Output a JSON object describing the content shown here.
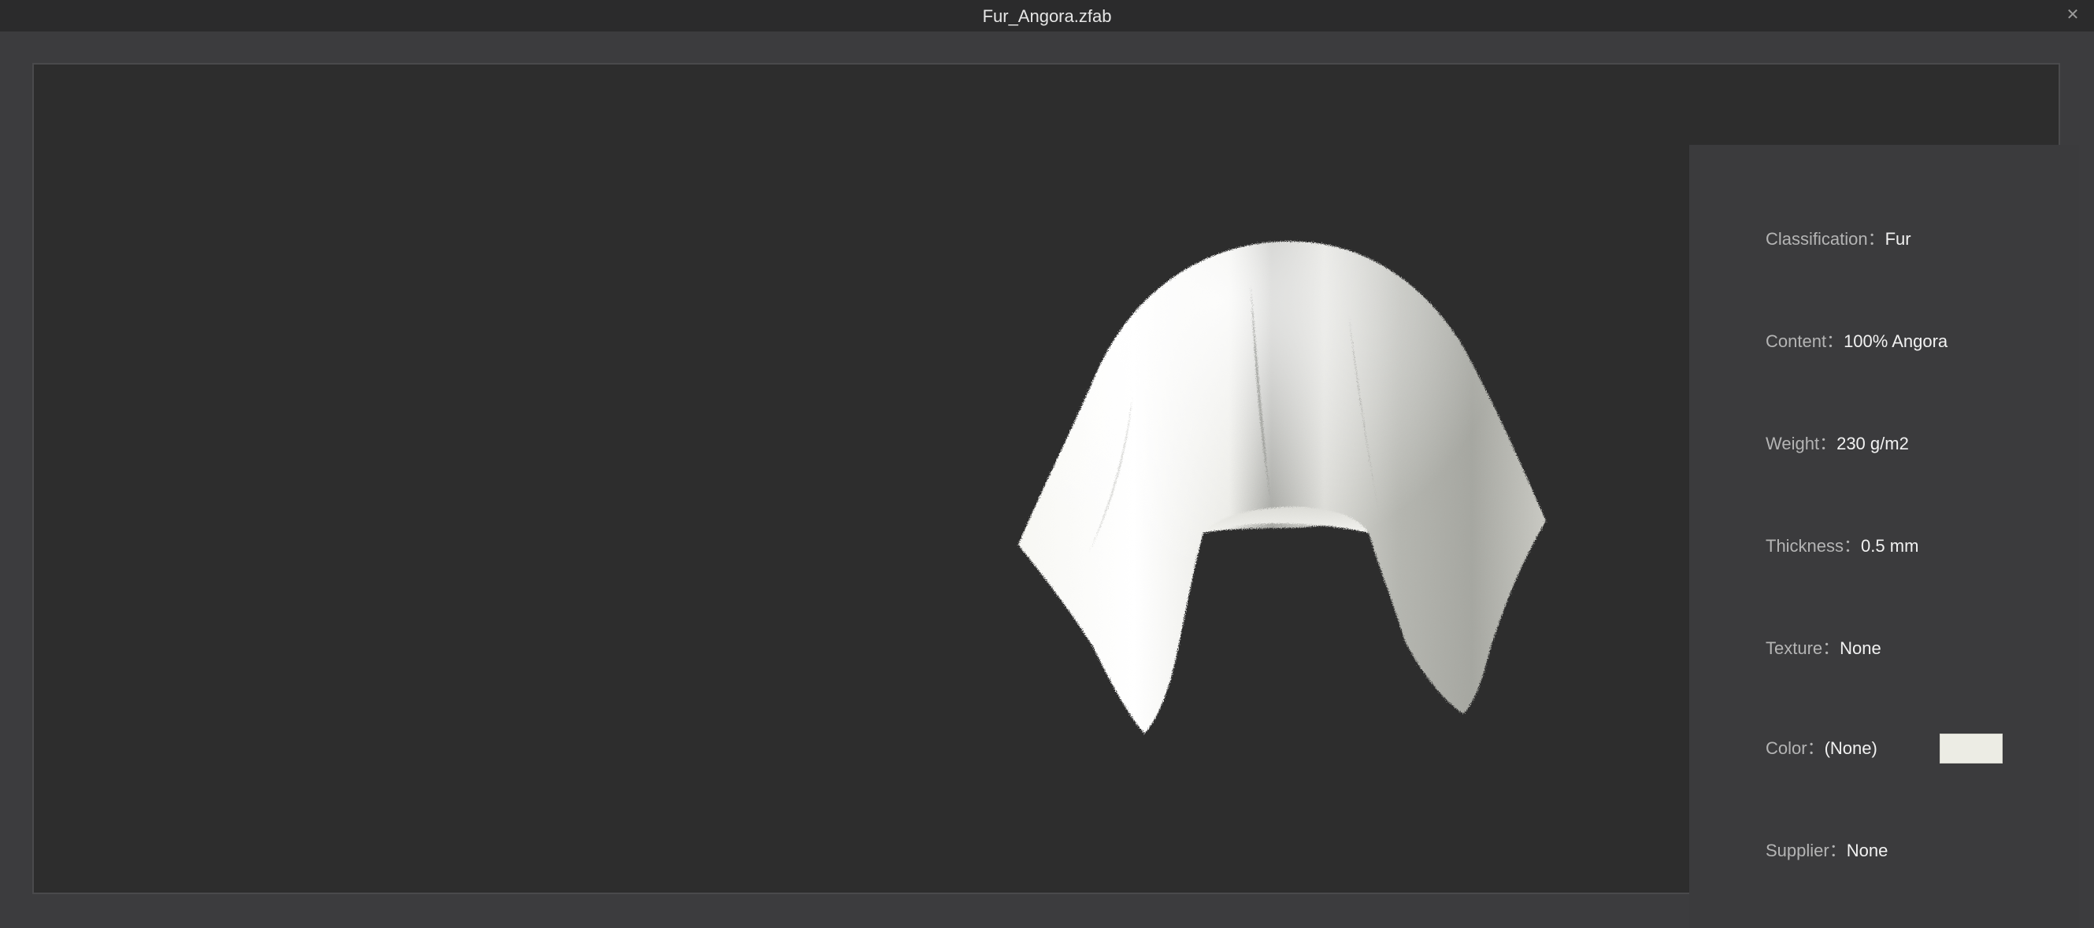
{
  "window": {
    "title": "Fur_Angora.zfab",
    "close_glyph": "✕"
  },
  "info": {
    "classification": {
      "label": "Classification：",
      "value": "Fur"
    },
    "content": {
      "label": "Content：",
      "value": "100% Angora"
    },
    "weight": {
      "label": "Weight：",
      "value": "230 g/m2"
    },
    "thickness": {
      "label": "Thickness：",
      "value": "0.5 mm"
    },
    "texture": {
      "label": "Texture：",
      "value": "None"
    },
    "color": {
      "label": "Color：",
      "value": "(None)",
      "swatch": "#ECECE4"
    },
    "supplier": {
      "label": "Supplier：",
      "value": "None"
    }
  },
  "colors": {
    "title_bar": "#2B2B2C",
    "frame": "#3C3C3E",
    "viewport": "#2D2D2D",
    "panel": "#3B3B3D",
    "fabric": "#F0F0EC"
  }
}
